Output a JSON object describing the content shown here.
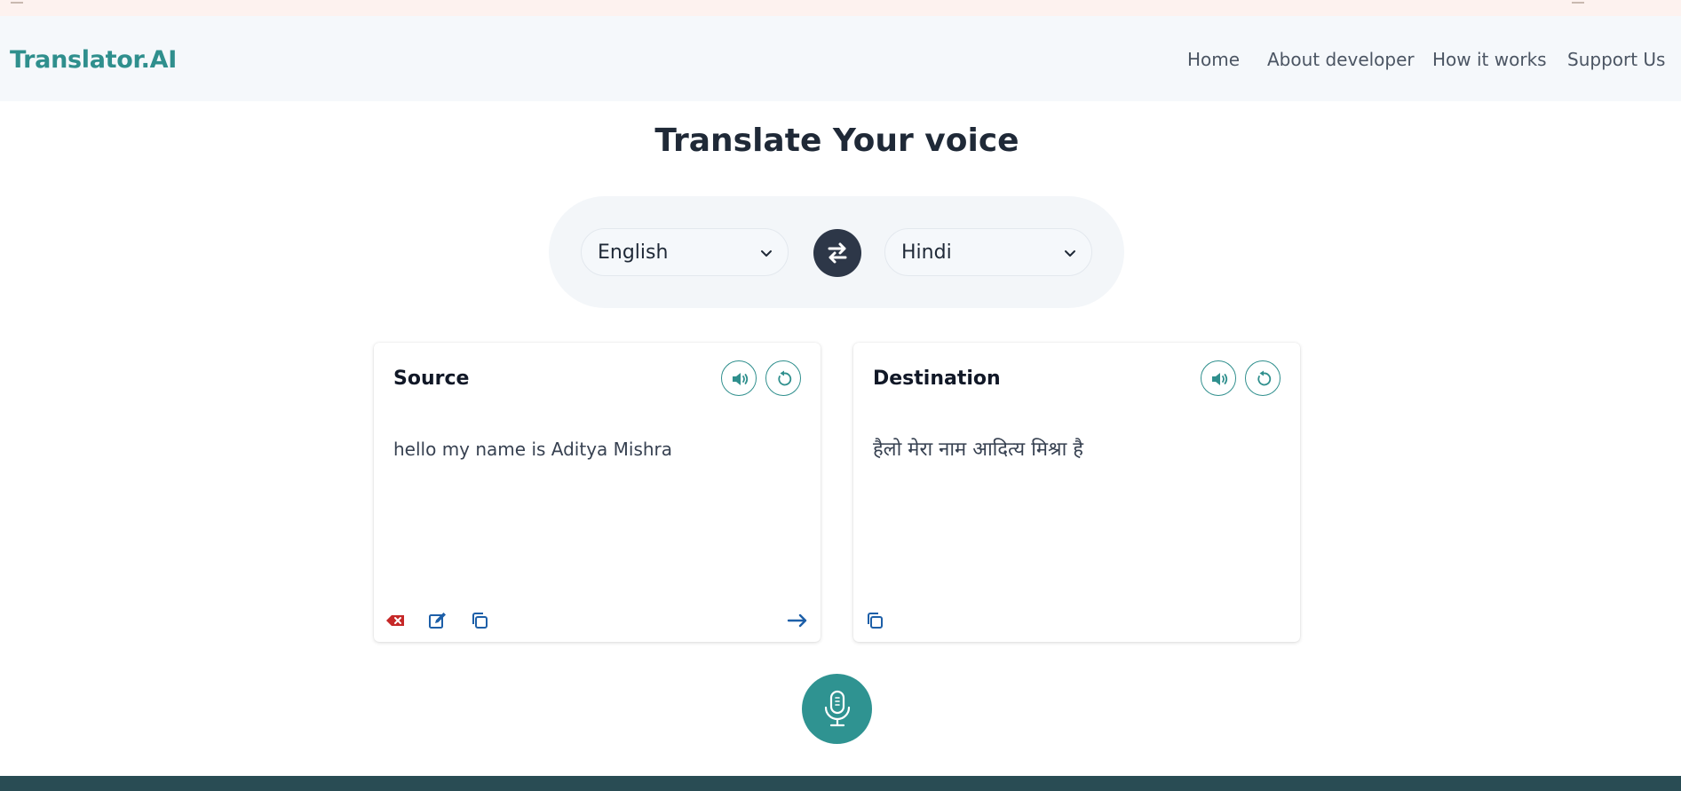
{
  "brand": {
    "name": "Translator.AI"
  },
  "nav": {
    "items": [
      {
        "label": "Home"
      },
      {
        "label": "About developer"
      },
      {
        "label": "How it works"
      },
      {
        "label": "Support Us"
      }
    ]
  },
  "main": {
    "title": "Translate Your voice",
    "source_language": "English",
    "target_language": "Hindi"
  },
  "source_card": {
    "title": "Source",
    "text": "hello my name is Aditya Mishra"
  },
  "destination_card": {
    "title": "Destination",
    "text": "हैलो मेरा नाम आदित्य मिश्रा है"
  },
  "icons": {
    "swap": "swap-arrows-icon",
    "speak": "speaker-icon",
    "reset": "rotate-icon",
    "clear": "clear-icon",
    "edit": "edit-icon",
    "copy": "copy-icon",
    "translate": "arrow-right-icon",
    "mic": "microphone-icon"
  },
  "colors": {
    "brand": "#2f8f8d",
    "mic_button": "#2f9391",
    "swap_button": "#2d3748",
    "clear_icon": "#c62828",
    "edit_icon": "#1d5fa8",
    "footer": "#294c54"
  }
}
